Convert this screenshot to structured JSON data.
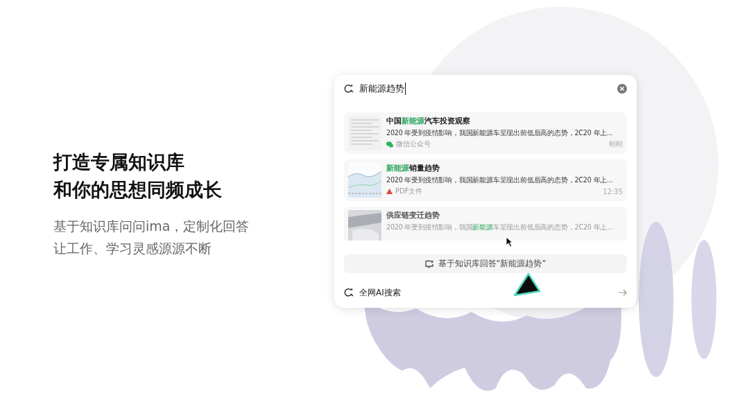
{
  "intro": {
    "headline": [
      "打造专属知识库",
      "和你的思想同频成长"
    ],
    "subtitle": "基于知识库问问ima，定制化回答让工作、学习灵感源源不断"
  },
  "search": {
    "value": "新能源趋势"
  },
  "results": [
    {
      "kind": "document",
      "faded": false,
      "title": [
        {
          "text": "中国",
          "highlight": false
        },
        {
          "text": "新能源",
          "highlight": true
        },
        {
          "text": "汽车投资观察",
          "highlight": false
        }
      ],
      "snippet": [
        {
          "text": "2020 年受到疫情影响，我国新能源车呈现出前低后高的态势，2C20 年上...",
          "highlight": false
        }
      ],
      "source": {
        "kind": "wechat",
        "label": "微信公众号"
      },
      "time": "刚刚"
    },
    {
      "kind": "chart",
      "faded": false,
      "title": [
        {
          "text": "新能源",
          "highlight": true
        },
        {
          "text": "销量趋势",
          "highlight": false
        }
      ],
      "snippet": [
        {
          "text": "2020 年受到疫情影响，我国新能源车呈现出前低后高的态势，2C20 年上...",
          "highlight": false
        }
      ],
      "source": {
        "kind": "pdf",
        "label": "PDF文件"
      },
      "time": "12:35"
    },
    {
      "kind": "photo",
      "faded": true,
      "title": [
        {
          "text": "供应链变迁趋势",
          "highlight": false
        }
      ],
      "snippet": [
        {
          "text": "2020 年受到疫情影响，我国",
          "highlight": false
        },
        {
          "text": "新能源",
          "highlight": true
        },
        {
          "text": "车呈现出前低后高的态势，2C20 年上...",
          "highlight": false
        }
      ]
    }
  ],
  "answer_button": "基于知识库回答“新能源趋势”",
  "web_search": "全网AI搜索"
}
